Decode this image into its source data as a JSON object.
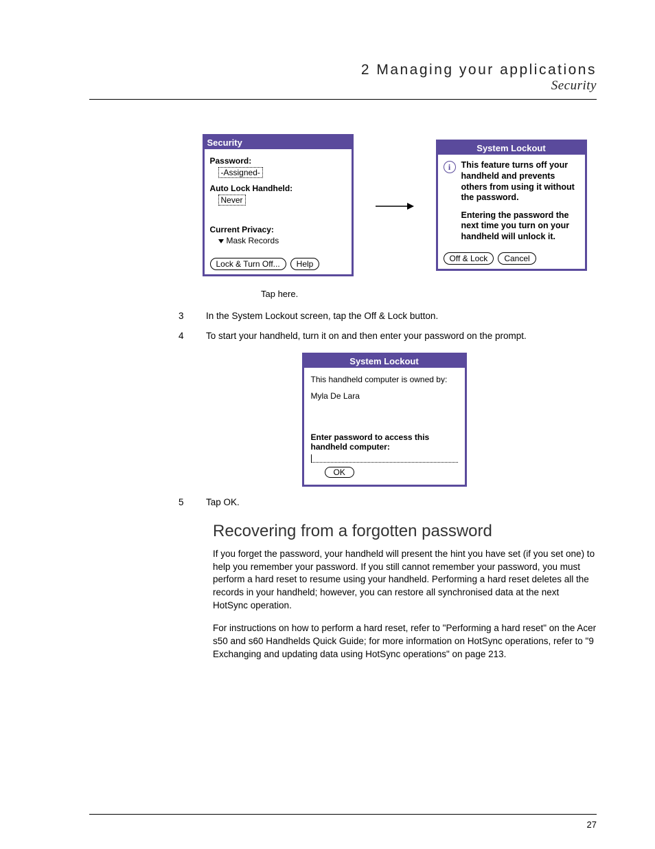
{
  "header": {
    "chapter": "2 Managing your applications",
    "section": "Security"
  },
  "security_screen": {
    "title": "Security",
    "password_label": "Password:",
    "password_value": "-Assigned-",
    "autolock_label": "Auto Lock Handheld:",
    "autolock_value": "Never",
    "privacy_label": "Current Privacy:",
    "privacy_value": "Mask Records",
    "lock_btn": "Lock & Turn Off...",
    "help_btn": "Help"
  },
  "lockout_dialog": {
    "title": "System Lockout",
    "para1": "This feature turns off your handheld and prevents others from using it without the password.",
    "para2": "Entering the password the next time you turn on your handheld will unlock it.",
    "off_btn": "Off & Lock",
    "cancel_btn": "Cancel"
  },
  "caption": "Tap here.",
  "steps": {
    "s3_num": "3",
    "s3_text": "In the System Lockout screen, tap the Off & Lock button.",
    "s4_num": "4",
    "s4_text": "To start your handheld, turn it on and then enter your password on the prompt.",
    "s5_num": "5",
    "s5_text": "Tap OK."
  },
  "owner_screen": {
    "title": "System Lockout",
    "owned_by": "This handheld computer is owned by:",
    "owner": "Myla De Lara",
    "enter_pw": "Enter password to access this handheld computer:",
    "ok_btn": "OK"
  },
  "recovering": {
    "heading": "Recovering from a forgotten password",
    "p1": "If you forget the password, your handheld will present the hint you have set (if you set one) to help you remember your password. If you still cannot remember your password, you must perform a hard reset to resume using your handheld. Performing a hard reset deletes all the records in your handheld; however, you can restore all synchronised data at the next HotSync operation.",
    "p2": "For instructions on how to perform a hard reset, refer to \"Performing a hard reset\" on the Acer s50 and s60 Handhelds Quick Guide; for more information on HotSync operations, refer to \"9 Exchanging and updating data using HotSync operations\" on page 213."
  },
  "page_number": "27"
}
